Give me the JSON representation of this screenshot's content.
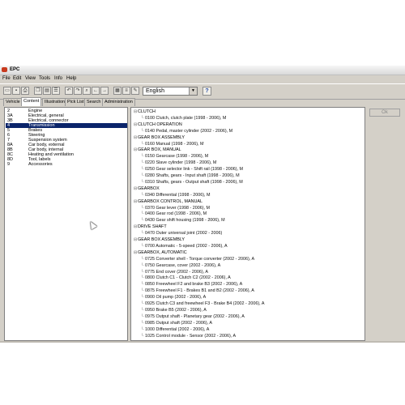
{
  "window": {
    "title": "EPC"
  },
  "menu": [
    "File",
    "Edit",
    "View",
    "Tools",
    "Info",
    "Help"
  ],
  "toolbar": {
    "language": "English",
    "help_label": "?"
  },
  "tabs": [
    "Vehicle",
    "Content",
    "Illustration",
    "Pick List",
    "Search",
    "Administration"
  ],
  "active_tab": "Content",
  "groups": [
    {
      "code": "2",
      "name": "Engine"
    },
    {
      "code": "3A",
      "name": "Electrical, general"
    },
    {
      "code": "3B",
      "name": "Electrical, connector"
    },
    {
      "code": "4",
      "name": "Transmission"
    },
    {
      "code": "5",
      "name": "Brakes"
    },
    {
      "code": "6",
      "name": "Steering"
    },
    {
      "code": "7",
      "name": "Suspension system"
    },
    {
      "code": "8A",
      "name": "Car body, external"
    },
    {
      "code": "8B",
      "name": "Car body, internal"
    },
    {
      "code": "8C",
      "name": "Heating and ventilation"
    },
    {
      "code": "8D",
      "name": "Tool, labels"
    },
    {
      "code": "9",
      "name": "Accessories"
    }
  ],
  "selected_group": "Transmission",
  "tree": [
    {
      "type": "header",
      "text": "CLUTCH"
    },
    {
      "type": "item",
      "text": "0100 Clutch, clutch plate  (1998 - 2006), M"
    },
    {
      "type": "header",
      "text": "CLUTCH OPERATION"
    },
    {
      "type": "item",
      "text": "0140 Pedal, master cylinder  (2002 - 2006), M"
    },
    {
      "type": "header",
      "text": "GEAR BOX ASSEMBLY"
    },
    {
      "type": "item",
      "text": "0160 Manual  (1998 - 2006), M"
    },
    {
      "type": "header",
      "text": "GEAR BOX, MANUAL"
    },
    {
      "type": "item",
      "text": "0150 Gearcase  (1998 - 2006), M"
    },
    {
      "type": "item",
      "text": "0220 Slave cylinder  (1998 - 2006), M"
    },
    {
      "type": "item",
      "text": "0250 Gear selector link - Shift rail  (1998 - 2006), M"
    },
    {
      "type": "item",
      "text": "0280 Shafts, gears - Input shaft  (1998 - 2006), M"
    },
    {
      "type": "item",
      "text": "0310 Shafts, gears - Output shaft  (1998 - 2006), M"
    },
    {
      "type": "header",
      "text": "GEARBOX"
    },
    {
      "type": "item",
      "text": "0340 Differential  (1998 - 2006), M"
    },
    {
      "type": "header",
      "text": "GEARBOX CONTROL, MANUAL"
    },
    {
      "type": "item",
      "text": "0370 Gear lever  (1998 - 2006), M"
    },
    {
      "type": "item",
      "text": "0400 Gear rod  (1998 - 2006), M"
    },
    {
      "type": "item",
      "text": "0430 Gear shift housing  (1998 - 2006), M"
    },
    {
      "type": "header",
      "text": "DRIVE SHAFT"
    },
    {
      "type": "item",
      "text": "0470 Outer universal joint  (2002 - 2006)"
    },
    {
      "type": "header",
      "text": "GEAR BOX ASSEMBLY"
    },
    {
      "type": "item",
      "text": "0700 Automatic - 5-speed  (2002 - 2006), A"
    },
    {
      "type": "header",
      "text": "GEARBOX, AUTOMATIC"
    },
    {
      "type": "item",
      "text": "0725 Converter shell - Torque converter  (2002 - 2006), A"
    },
    {
      "type": "item",
      "text": "0750 Gearcase, cover  (2002 - 2006), A"
    },
    {
      "type": "item",
      "text": "0775 End cover  (2002 - 2006), A"
    },
    {
      "type": "item",
      "text": "0800 Clutch C1 - Clutch C2  (2002 - 2006), A"
    },
    {
      "type": "item",
      "text": "0850 Freewheel F2 and brake B3  (2002 - 2006), A"
    },
    {
      "type": "item",
      "text": "0875 Freewheel F1 - Brakes B1 and B2  (2002 - 2006), A"
    },
    {
      "type": "item",
      "text": "0900 Oil pump  (2002 - 2006), A"
    },
    {
      "type": "item",
      "text": "0925 Clutch C3 and freewheel F3 - Brake B4  (2002 - 2006), A"
    },
    {
      "type": "item",
      "text": "0950 Brake B5  (2002 - 2006), A"
    },
    {
      "type": "item",
      "text": "0975 Output shaft - Planetary gear  (2002 - 2006), A"
    },
    {
      "type": "item",
      "text": "0985 Output shaft  (2002 - 2006), A"
    },
    {
      "type": "item",
      "text": "1000 Differential  (2002 - 2006), A"
    },
    {
      "type": "item",
      "text": "1025 Control module - Sensor  (2002 - 2006), A"
    }
  ],
  "buttons": {
    "ok": "Ok"
  },
  "colors": {
    "selection": "#0a246a",
    "chrome": "#d4d0c8",
    "logo": "#c83a1e"
  }
}
